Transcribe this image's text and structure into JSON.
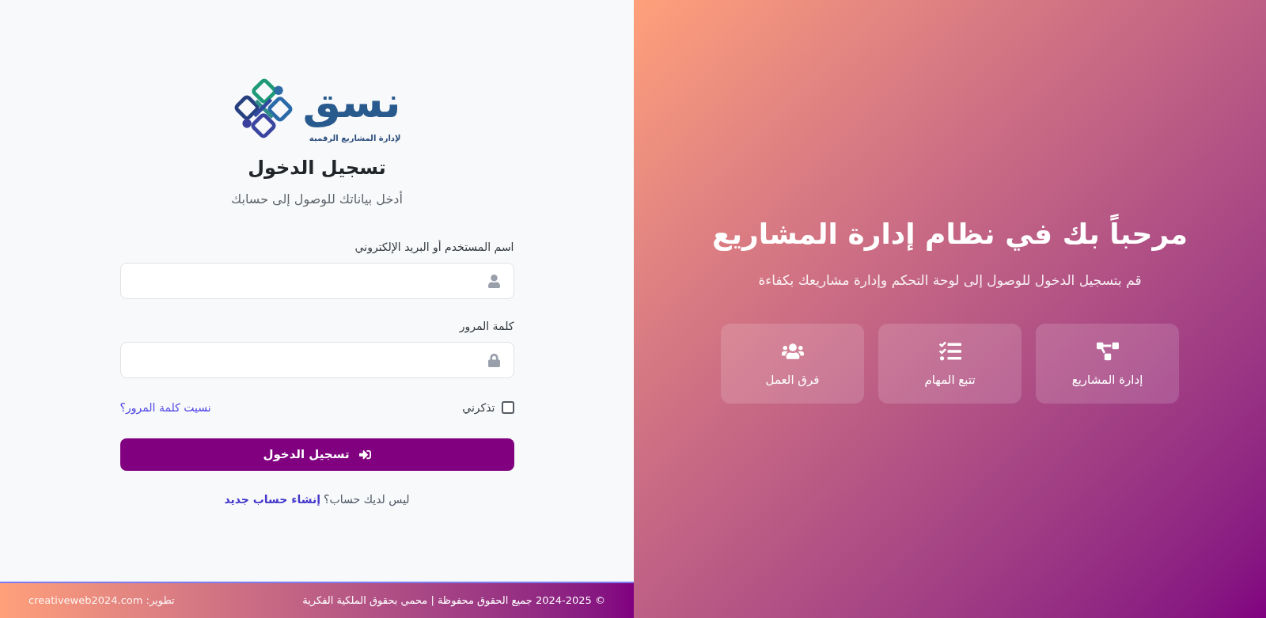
{
  "welcome_panel": {
    "title": "مرحباً بك في نظام إدارة المشاريع",
    "subtitle": "قم بتسجيل الدخول للوصول إلى لوحة التحكم وإدارة مشاريعك بكفاءة",
    "features": [
      {
        "kind": "projects",
        "label": "إدارة المشاريع"
      },
      {
        "kind": "tasks",
        "label": "تتبع المهام"
      },
      {
        "kind": "teams",
        "label": "فرق العمل"
      }
    ]
  },
  "login_panel": {
    "logo": {
      "name": "نسق",
      "tagline": "لإدارة المشاريع الرقمية"
    },
    "title": "تسجيل الدخول",
    "subtitle": "أدخل بياناتك للوصول إلى حسابك",
    "fields": [
      {
        "kind": "user",
        "label": "اسم المستخدم أو البريد الإلكتروني"
      },
      {
        "kind": "password",
        "label": "كلمة المرور"
      }
    ],
    "remember": {
      "label": "تذكرني",
      "checked": false
    },
    "forgot_link": "نسيت كلمة المرور؟",
    "submit_button": "تسجيل الدخول",
    "signup": {
      "text": "ليس لديك حساب؟",
      "link": "إنشاء حساب جديد"
    }
  },
  "footer": {
    "copyright": "© 2024-2025 جميع الحقوق محفوظة | محمي بحقوق الملكية الفكرية",
    "credit": "تطوير: creativeweb2024.com"
  }
}
